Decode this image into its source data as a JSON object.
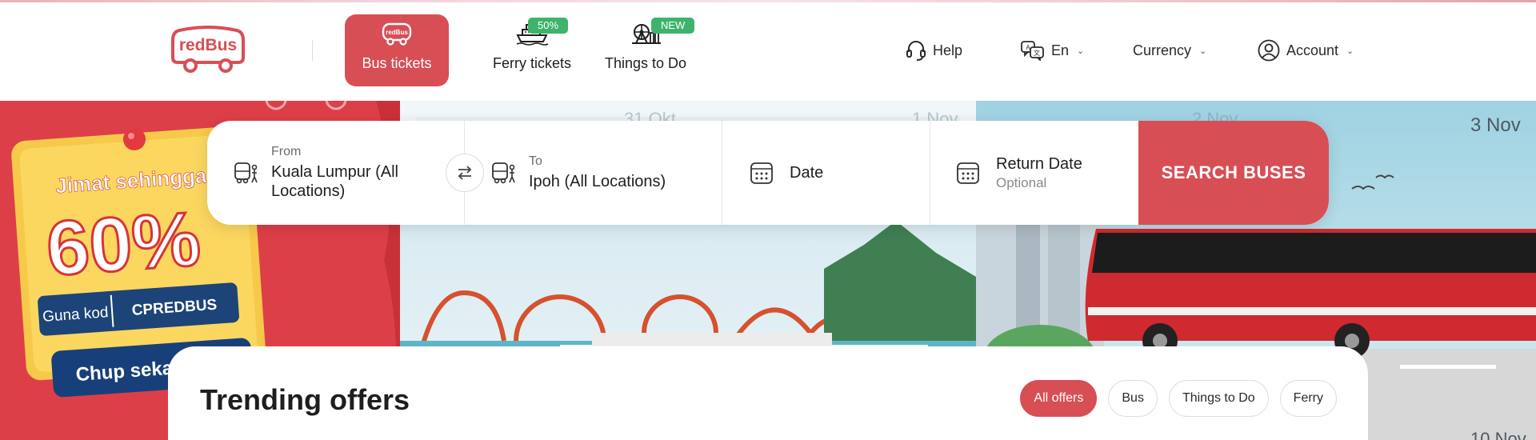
{
  "brand": {
    "logo_text": "redBus",
    "accent_color": "#d84e55",
    "badge_color": "#3eb36c"
  },
  "nav": {
    "bus": {
      "label": "Bus tickets",
      "icon": "bus-icon"
    },
    "ferry": {
      "label": "Ferry tickets",
      "badge": "50%",
      "icon": "ferry-icon"
    },
    "things": {
      "label": "Things to Do",
      "badge": "NEW",
      "icon": "ferris-wheel-icon"
    }
  },
  "header_right": {
    "help": "Help",
    "language": "En",
    "currency": "Currency",
    "account": "Account"
  },
  "promo": {
    "headline": "Jimat sehingga",
    "discount": "60%",
    "code_label": "Guna kod",
    "code": "CPREDBUS",
    "cta": "Chup seka"
  },
  "hero_dates": [
    "31 Okt",
    "1 Nov",
    "2 Nov",
    "3 Nov",
    "10 Nov"
  ],
  "search": {
    "from_label": "From",
    "from_value": "Kuala Lumpur (All Locations)",
    "to_label": "To",
    "to_value": "Ipoh (All Locations)",
    "date_label": "Date",
    "return_label": "Return Date",
    "return_hint": "Optional",
    "button": "SEARCH BUSES"
  },
  "offers": {
    "title": "Trending offers",
    "filters": [
      "All offers",
      "Bus",
      "Things to Do",
      "Ferry"
    ],
    "active_filter": "All offers"
  }
}
